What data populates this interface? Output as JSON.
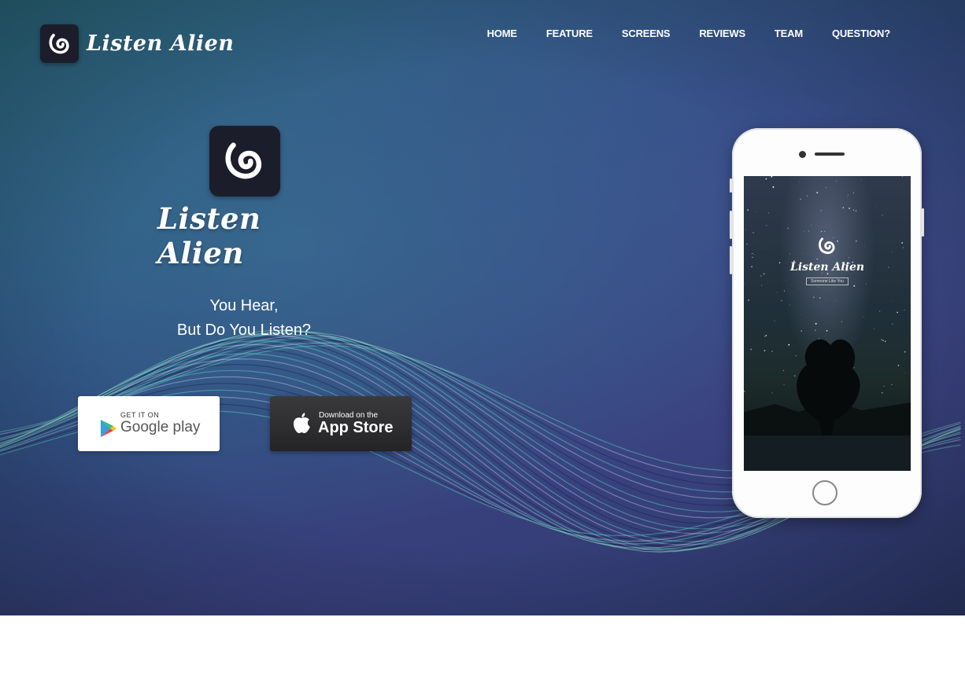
{
  "brand": {
    "name": "Listen Alien",
    "icon": "listen-alien-logo-icon"
  },
  "nav": {
    "items": [
      "HOME",
      "FEATURE",
      "SCREENS",
      "REVIEWS",
      "TEAM",
      "QUESTION?"
    ]
  },
  "hero": {
    "title": "Listen Alien",
    "tagline_line1": "You Hear,",
    "tagline_line2": "But Do You Listen?"
  },
  "store_buttons": {
    "google": {
      "small": "GET IT ON",
      "big": "Google play",
      "icon": "google-play-icon"
    },
    "apple": {
      "small": "Download on the",
      "big": "App Store",
      "icon": "apple-icon"
    }
  },
  "phone_screen": {
    "title": "Listen Alien",
    "subtitle": "Someone Like You"
  },
  "colors": {
    "hero_top": "#2b6a7e",
    "hero_bottom": "#2d3a6c",
    "text": "#ffffff",
    "app_icon_bg": "#1b1e2a"
  }
}
